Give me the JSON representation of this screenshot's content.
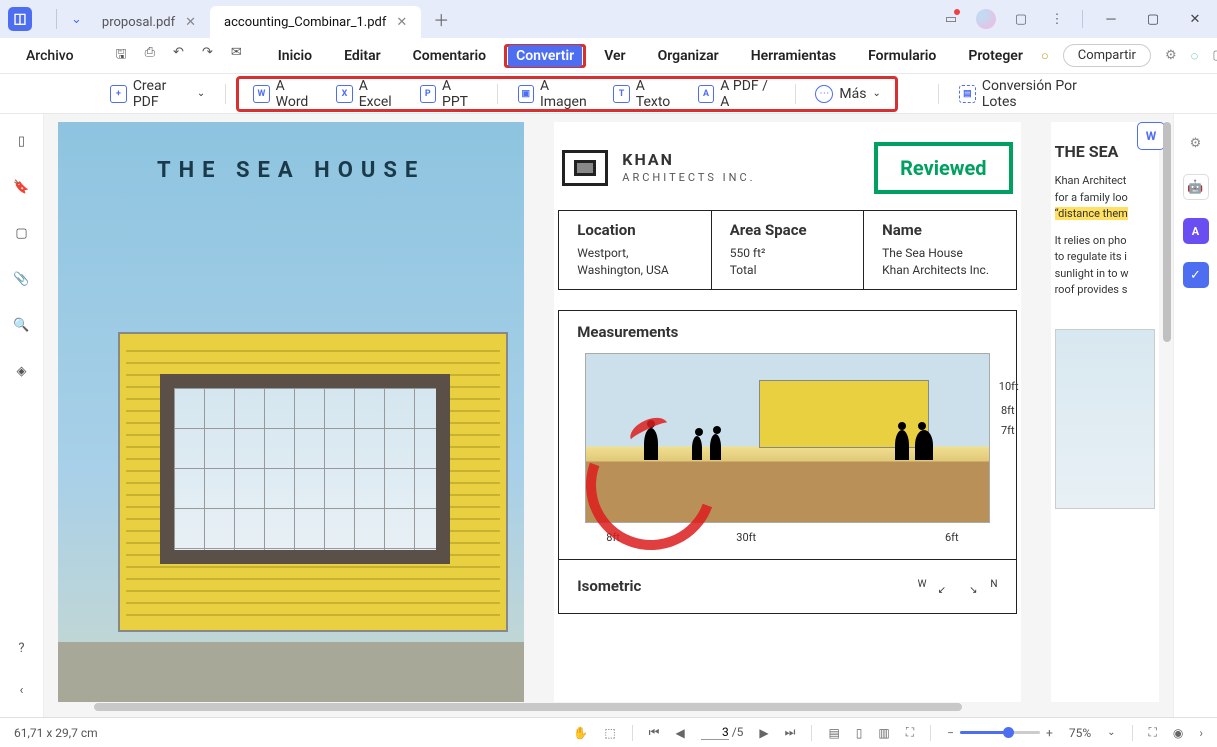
{
  "tabs": {
    "inactive": "proposal.pdf",
    "active": "accounting_Combinar_1.pdf"
  },
  "menu": {
    "archivo": "Archivo",
    "items": [
      "Inicio",
      "Editar",
      "Comentario",
      "Convertir",
      "Ver",
      "Organizar",
      "Herramientas",
      "Formulario",
      "Proteger"
    ],
    "compartir": "Compartir"
  },
  "toolbar": {
    "crear": "Crear PDF",
    "word": "A Word",
    "excel": "A Excel",
    "ppt": "A PPT",
    "imagen": "A Imagen",
    "texto": "A Texto",
    "pdfa": "A PDF / A",
    "mas": "Más",
    "lotes": "Conversión Por Lotes"
  },
  "document": {
    "cover_title": "THE SEA HOUSE",
    "logo_name": "KHAN",
    "logo_sub": "ARCHITECTS INC.",
    "reviewed": "Reviewed",
    "info": {
      "location_label": "Location",
      "location_val1": "Westport,",
      "location_val2": "Washington, USA",
      "area_label": "Area Space",
      "area_val1": "550 ft²",
      "area_val2": "Total",
      "name_label": "Name",
      "name_val1": "The Sea House",
      "name_val2": "Khan Architects Inc."
    },
    "measurements": "Measurements",
    "dims": {
      "d10": "10ft",
      "d8": "8ft",
      "d7": "7ft",
      "d8b": "8ft",
      "d30": "30ft",
      "d6": "6ft"
    },
    "isometric": "Isometric",
    "compass": {
      "w": "W",
      "n": "N"
    },
    "p3_title": "THE SEA",
    "p3_para1a": "Khan Architect",
    "p3_para1b": "for a family loo",
    "p3_para1c": "“distance them",
    "p3_para2a": "It relies on pho",
    "p3_para2b": "to regulate its i",
    "p3_para2c": "sunlight in to w",
    "p3_para2d": "roof provides s"
  },
  "status": {
    "dims": "61,71 x 29,7 cm",
    "page_current": "3",
    "page_total": "/5",
    "zoom": "75%"
  }
}
